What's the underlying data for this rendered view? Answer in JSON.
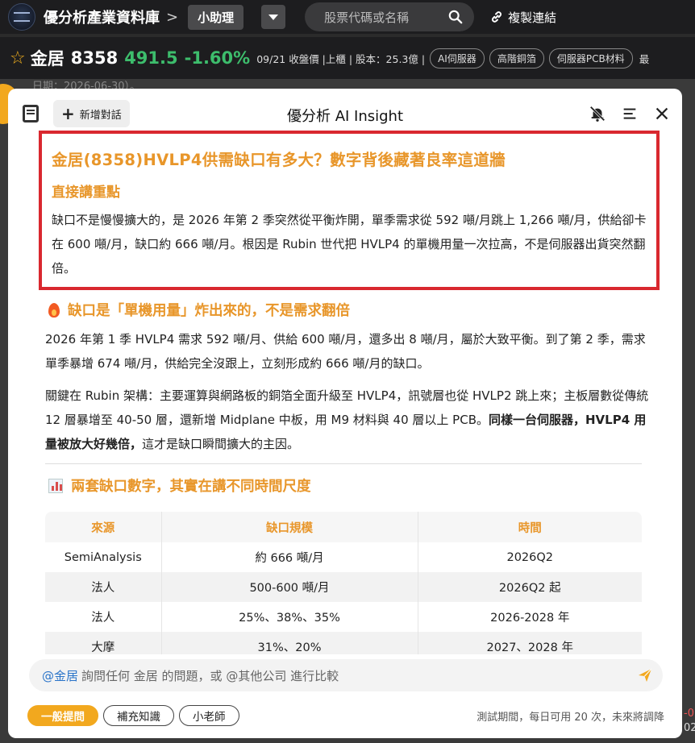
{
  "topbar": {
    "brand": "優分析產業資料庫",
    "separator": ">",
    "helper": "小助理",
    "search_placeholder": "股票代碼或名稱",
    "copy_link": "複製連結"
  },
  "stock": {
    "name": "金居",
    "code": "8358",
    "price": "491.5",
    "change": "-1.60%",
    "meta": "09/21 收盤價 |上櫃 | 股本：25.3億 |",
    "tags": [
      "AI伺服器",
      "高階銅箔",
      "伺服器PCB材料"
    ],
    "more": "最"
  },
  "background": {
    "date_text": "日期：2026-06-30）。",
    "right_value_1": "-0.",
    "right_value_2": "02"
  },
  "modal": {
    "new_chat": "新增對話",
    "title": "優分析 AI Insight",
    "highlight": {
      "title": "金居(8358)HVLP4供需缺口有多大？數字背後藏著良率這道牆",
      "subtitle": "直接講重點",
      "body": "缺口不是慢慢擴大的，是 2026 年第 2 季突然從平衡炸開，單季需求從 592 噸/月跳上 1,266 噸/月，供給卻卡在 600 噸/月，缺口約 666 噸/月。根因是 Rubin 世代把 HVLP4 的單機用量一次拉高，不是伺服器出貨突然翻倍。"
    },
    "section1": {
      "title": "缺口是「單機用量」炸出來的，不是需求翻倍",
      "p1": "2026 年第 1 季 HVLP4 需求 592 噸/月、供給 600 噸/月，還多出 8 噸/月，屬於大致平衡。到了第 2 季，需求單季暴增 674 噸/月，供給完全沒跟上，立刻形成約 666 噸/月的缺口。",
      "p2_normal": "關鍵在 Rubin 架構：主要運算與網路板的銅箔全面升級至 HVLP4，訊號層也從 HVLP2 跳上來；主板層數從傳統 12 層暴增至 40-50 層，還新增 Midplane 中板，用 M9 材料與 40 層以上 PCB。",
      "p2_bold": "同樣一台伺服器，HVLP4 用量被放大好幾倍，",
      "p2_tail": "這才是缺口瞬間擴大的主因。"
    },
    "section2": {
      "title": "兩套缺口數字，其實在講不同時間尺度"
    },
    "table": {
      "headers": [
        "來源",
        "缺口規模",
        "時間"
      ],
      "rows": [
        [
          "SemiAnalysis",
          "約 666 噸/月",
          "2026Q2"
        ],
        [
          "法人",
          "500-600 噸/月",
          "2026Q2 起"
        ],
        [
          "法人",
          "25%、38%、35%",
          "2026-2028 年"
        ],
        [
          "大摩",
          "31%、20%",
          "2027、2028 年"
        ]
      ]
    },
    "input": {
      "mention": "@金居",
      "placeholder": "詢問任何 金居 的問題，或 @其他公司 進行比較"
    },
    "modes": [
      "一般提問",
      "補充知識",
      "小老師"
    ],
    "active_mode": "一般提問",
    "footnote": "測試期間，每日可用 20 次，未來將調降"
  }
}
